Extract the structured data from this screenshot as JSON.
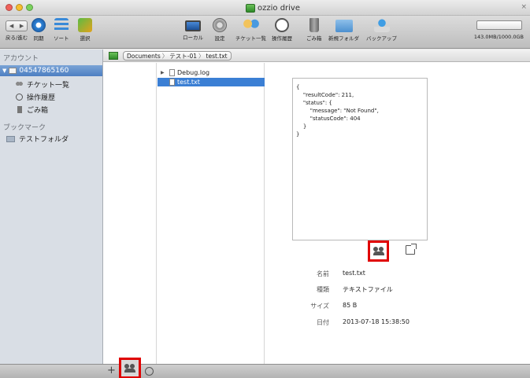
{
  "window": {
    "title": "ozzio drive",
    "close_glyph": "×"
  },
  "toolbar": {
    "items": [
      {
        "label": "戻る/進む",
        "icon": "back-forward-icon"
      },
      {
        "label": "同期",
        "icon": "sync-icon"
      },
      {
        "label": "ソート",
        "icon": "sort-icon"
      },
      {
        "label": "選択",
        "icon": "select-icon"
      },
      {
        "label": "ローカル",
        "icon": "local-icon"
      },
      {
        "label": "設定",
        "icon": "settings-icon"
      },
      {
        "label": "チケット一覧",
        "icon": "tickets-icon"
      },
      {
        "label": "操作履歴",
        "icon": "history-icon"
      },
      {
        "label": "ごみ箱",
        "icon": "trash-icon"
      },
      {
        "label": "新規フォルダ",
        "icon": "new-folder-icon"
      },
      {
        "label": "バックアップ",
        "icon": "backup-icon"
      }
    ],
    "nav_back": "◀",
    "nav_forward": "▶",
    "storage": {
      "text": "143.0MB/1000.0GB",
      "used_fraction": 0.000143
    }
  },
  "sidebar": {
    "accounts_header": "アカウント",
    "account_name": "04547865160",
    "items": [
      {
        "label": "チケット一覧",
        "icon": "tickets-icon"
      },
      {
        "label": "操作履歴",
        "icon": "history-icon"
      },
      {
        "label": "ごみ箱",
        "icon": "trash-icon"
      }
    ],
    "bookmarks_header": "ブックマーク",
    "bookmarks": [
      {
        "label": "テストフォルダ",
        "icon": "folder-icon"
      }
    ]
  },
  "path": {
    "segments": [
      "Documents",
      "テスト-01",
      "test.txt"
    ],
    "separator": "〉"
  },
  "files": [
    {
      "name": "Debug.log",
      "selected": false,
      "disclosure": "▶"
    },
    {
      "name": "test.txt",
      "selected": true,
      "disclosure": ""
    }
  ],
  "preview": {
    "content": "{\n    \"resultCode\": 211,\n    \"status\": {\n        \"message\": \"Not Found\",\n        \"statusCode\": 404\n    }\n}"
  },
  "info": {
    "rows": [
      {
        "label": "名前",
        "value": "test.txt"
      },
      {
        "label": "種類",
        "value": "テキストファイル"
      },
      {
        "label": "サイズ",
        "value": "85 B"
      },
      {
        "label": "日付",
        "value": "2013-07-18 15:38:50"
      }
    ]
  },
  "bottombar": {
    "add_glyph": "+"
  }
}
